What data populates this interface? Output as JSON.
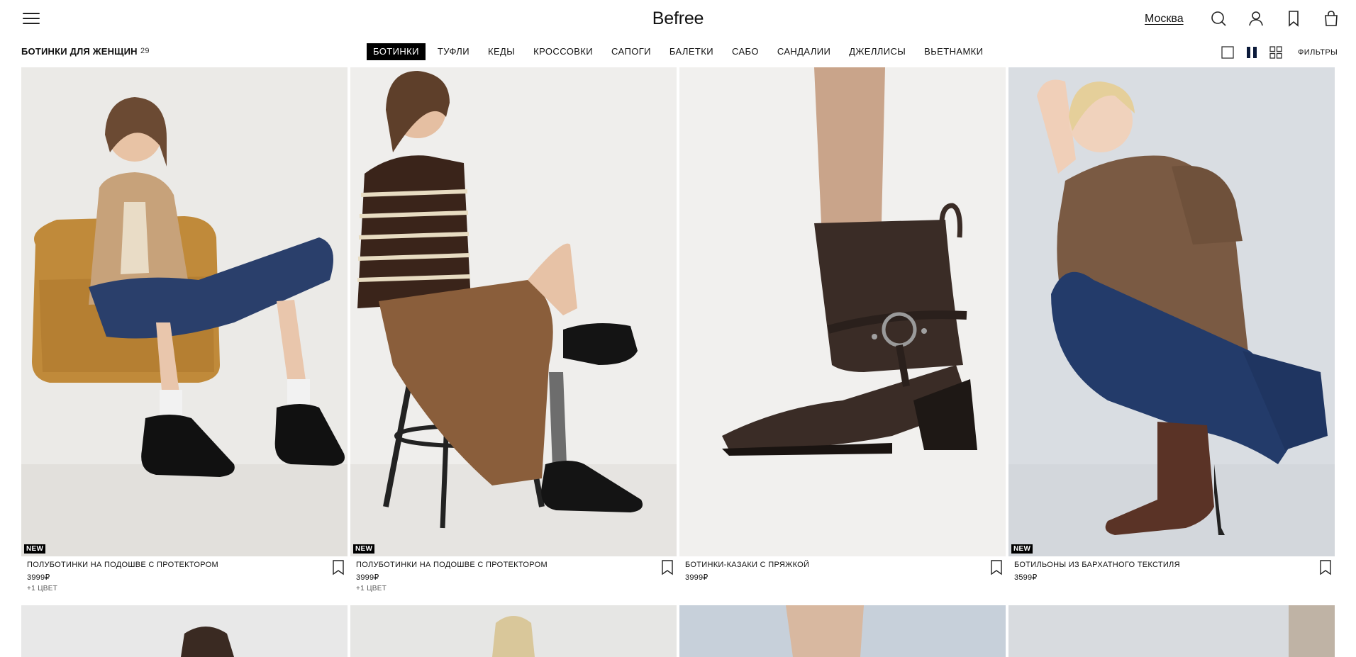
{
  "header": {
    "logo": "Befree",
    "city": "Москва",
    "icons": [
      "menu-icon",
      "search-icon",
      "account-icon",
      "bookmark-icon",
      "bag-icon"
    ]
  },
  "listing": {
    "title": "БОТИНКИ ДЛЯ ЖЕНЩИН",
    "count": "29",
    "filters_label": "ФИЛЬТРЫ",
    "view_icons": [
      "single-column-view-icon",
      "two-column-view-icon",
      "four-column-view-icon"
    ]
  },
  "categories": [
    {
      "label": "БОТИНКИ",
      "active": true
    },
    {
      "label": "ТУФЛИ",
      "active": false
    },
    {
      "label": "КЕДЫ",
      "active": false
    },
    {
      "label": "КРОССОВКИ",
      "active": false
    },
    {
      "label": "САПОГИ",
      "active": false
    },
    {
      "label": "БАЛЕТКИ",
      "active": false
    },
    {
      "label": "САБО",
      "active": false
    },
    {
      "label": "САНДАЛИИ",
      "active": false
    },
    {
      "label": "ДЖЕЛЛИСЫ",
      "active": false
    },
    {
      "label": "ВЬЕТНАМКИ",
      "active": false
    }
  ],
  "products": [
    {
      "name": "ПОЛУБОТИНКИ НА ПОДОШВЕ С ПРОТЕКТОРОМ",
      "price": "3999₽",
      "colors": "+1 ЦВЕТ",
      "badge": "NEW"
    },
    {
      "name": "ПОЛУБОТИНКИ НА ПОДОШВЕ С ПРОТЕКТОРОМ",
      "price": "3999₽",
      "colors": "+1 ЦВЕТ",
      "badge": "NEW"
    },
    {
      "name": "БОТИНКИ-КАЗАКИ С ПРЯЖКОЙ",
      "price": "3999₽",
      "colors": "",
      "badge": ""
    },
    {
      "name": "БОТИЛЬОНЫ ИЗ БАРХАТНОГО ТЕКСТИЛЯ",
      "price": "3599₽",
      "colors": "",
      "badge": "NEW"
    }
  ],
  "colors": {
    "text": "#111111",
    "active_tab_bg": "#000000",
    "view_active": "#0b1a3a"
  }
}
